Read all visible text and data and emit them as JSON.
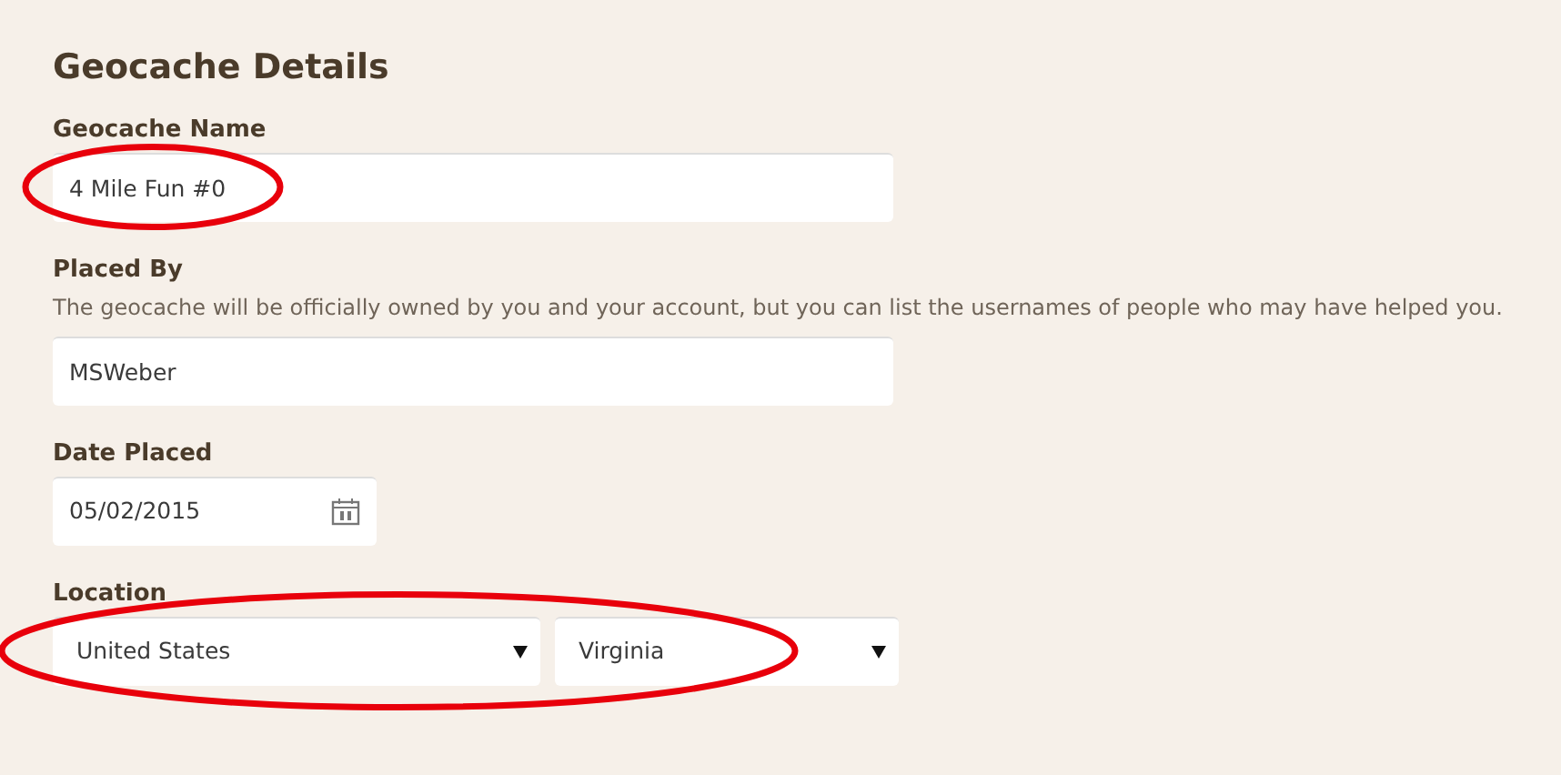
{
  "heading": "Geocache Details",
  "fields": [
    {
      "kind": "text",
      "label": "Geocache Name",
      "value": "4 Mile Fun #0",
      "highlighted": true
    },
    {
      "kind": "text",
      "label": "Placed By",
      "help": "The geocache will be officially owned by you and your account, but you can list the usernames of people who may have helped you.",
      "value": "MSWeber",
      "highlighted": false
    },
    {
      "kind": "date",
      "label": "Date Placed",
      "value": "05/02/2015",
      "highlighted": false
    },
    {
      "kind": "selects",
      "label": "Location",
      "selects": [
        {
          "value": "United States"
        },
        {
          "value": "Virginia"
        }
      ],
      "highlighted": true
    }
  ]
}
